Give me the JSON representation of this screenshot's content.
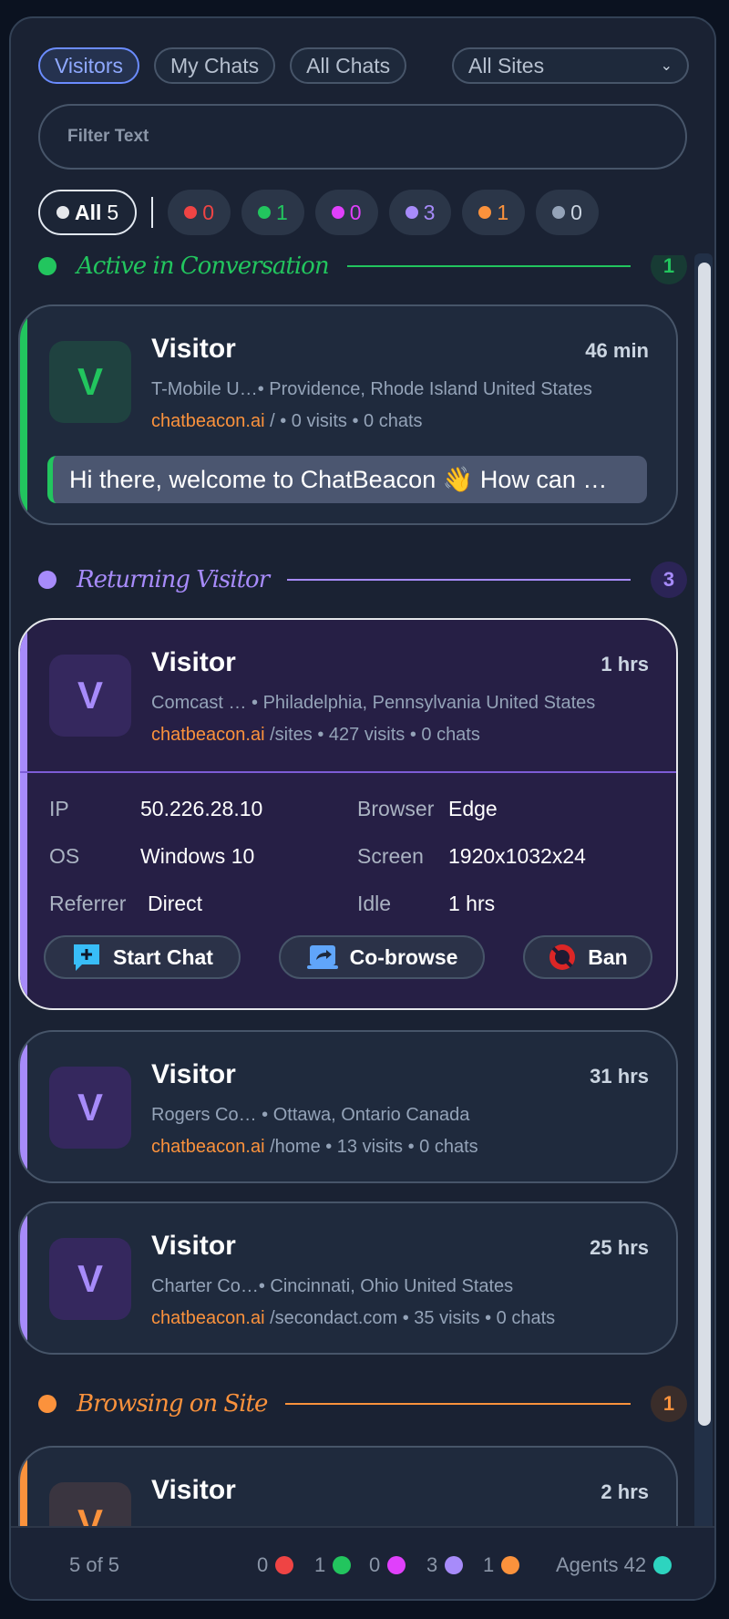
{
  "tabs": [
    {
      "label": "Visitors",
      "active": true
    },
    {
      "label": "My Chats",
      "active": false
    },
    {
      "label": "All Chats",
      "active": false
    }
  ],
  "site_select": {
    "value": "All Sites"
  },
  "filter": {
    "placeholder": "Filter Text"
  },
  "chips": {
    "all_label": "All",
    "all_count": "5",
    "status": [
      {
        "count": "0",
        "color": "#ef4444"
      },
      {
        "count": "1",
        "color": "#22c55e"
      },
      {
        "count": "0",
        "color": "#e040fb"
      },
      {
        "count": "3",
        "color": "#a78bfa"
      },
      {
        "count": "1",
        "color": "#fb923c"
      },
      {
        "count": "0",
        "color": "#94a3b8"
      }
    ]
  },
  "sections": {
    "active": {
      "title": "Active in Conversation",
      "count": "1",
      "color": "#22c55e"
    },
    "returning": {
      "title": "Returning Visitor",
      "count": "3",
      "color": "#a78bfa"
    },
    "browsing": {
      "title": "Browsing on Site",
      "count": "1",
      "color": "#fb923c"
    }
  },
  "visitors": [
    {
      "avatar": "V",
      "name": "Visitor",
      "time": "46 min",
      "isp": "T-Mobile U…",
      "location": "• Providence, Rhode Island United States",
      "site": "chatbeacon.ai",
      "path": " / • 0 visits • 0 chats",
      "message": "Hi there, welcome to ChatBeacon 👋 How can …"
    },
    {
      "avatar": "V",
      "name": "Visitor",
      "time": "1 hrs",
      "isp": "Comcast …",
      "location": " • Philadelphia, Pennsylvania United States",
      "site": "chatbeacon.ai",
      "path": " /sites • 427 visits • 0 chats",
      "details": {
        "ip_label": "IP",
        "ip": "50.226.28.10",
        "browser_label": "Browser",
        "browser": "Edge",
        "os_label": "OS",
        "os": "Windows 10",
        "screen_label": "Screen",
        "screen": "1920x1032x24",
        "referrer_label": "Referrer",
        "referrer": "Direct",
        "idle_label": "Idle",
        "idle": "1 hrs"
      },
      "actions": {
        "start_chat": "Start Chat",
        "cobrowse": "Co-browse",
        "ban": "Ban"
      }
    },
    {
      "avatar": "V",
      "name": "Visitor",
      "time": "31 hrs",
      "isp": "Rogers Co…",
      "location": " • Ottawa, Ontario Canada",
      "site": "chatbeacon.ai",
      "path": " /home • 13 visits • 0 chats"
    },
    {
      "avatar": "V",
      "name": "Visitor",
      "time": "25 hrs",
      "isp": "Charter Co…",
      "location": "• Cincinnati, Ohio United States",
      "site": "chatbeacon.ai",
      "path": " /secondact.com • 35 visits • 0 chats"
    },
    {
      "avatar": "V",
      "name": "Visitor",
      "time": "2 hrs"
    }
  ],
  "footer": {
    "count": "5 of 5",
    "status": [
      {
        "count": "0",
        "color": "#ef4444"
      },
      {
        "count": "1",
        "color": "#22c55e"
      },
      {
        "count": "0",
        "color": "#e040fb"
      },
      {
        "count": "3",
        "color": "#a78bfa"
      },
      {
        "count": "1",
        "color": "#fb923c"
      }
    ],
    "agents_label": "Agents 42",
    "agents_color": "#2dd4bf"
  }
}
